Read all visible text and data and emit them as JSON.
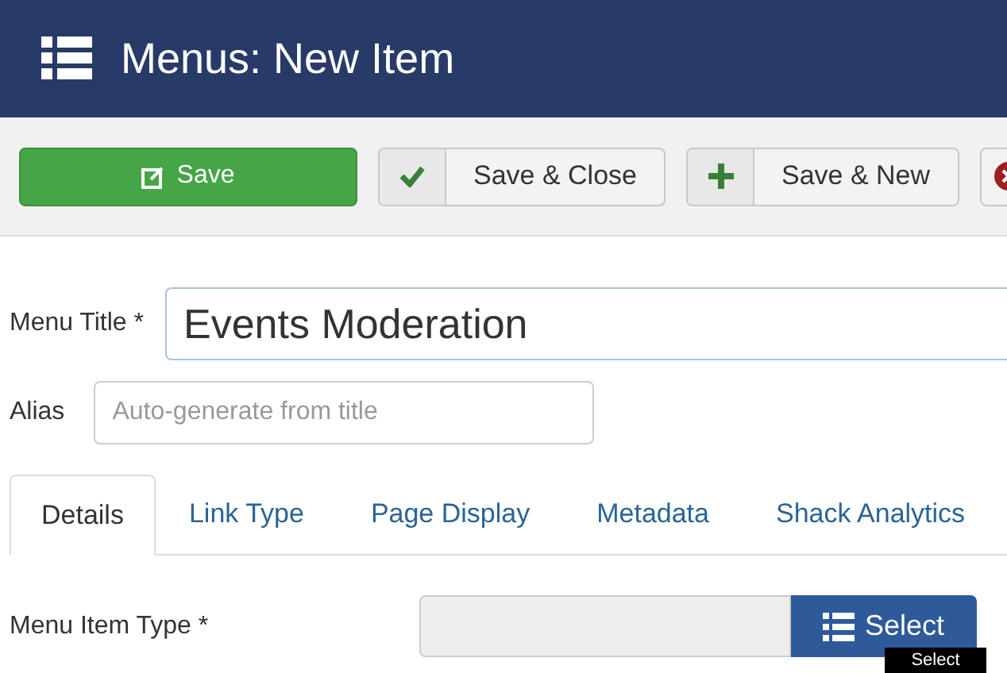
{
  "header": {
    "title": "Menus: New Item"
  },
  "toolbar": [
    {
      "kind": "primary",
      "label": "Save"
    },
    {
      "kind": "check",
      "label": "Save & Close"
    },
    {
      "kind": "plus",
      "label": "Save & New"
    },
    {
      "kind": "cancel"
    }
  ],
  "form": {
    "title_label": "Menu Title *",
    "title_value": "Events Moderation",
    "alias_label": "Alias",
    "alias_placeholder": "Auto-generate from title"
  },
  "tabs": [
    {
      "label": "Details",
      "selected": true
    },
    {
      "label": "Link Type",
      "selected": false
    },
    {
      "label": "Page Display",
      "selected": false
    },
    {
      "label": "Metadata",
      "selected": false
    },
    {
      "label": "Shack Analytics",
      "selected": false
    }
  ],
  "menu_item_type": {
    "label": "Menu Item Type *",
    "button": "Select",
    "tooltip": "Select"
  }
}
